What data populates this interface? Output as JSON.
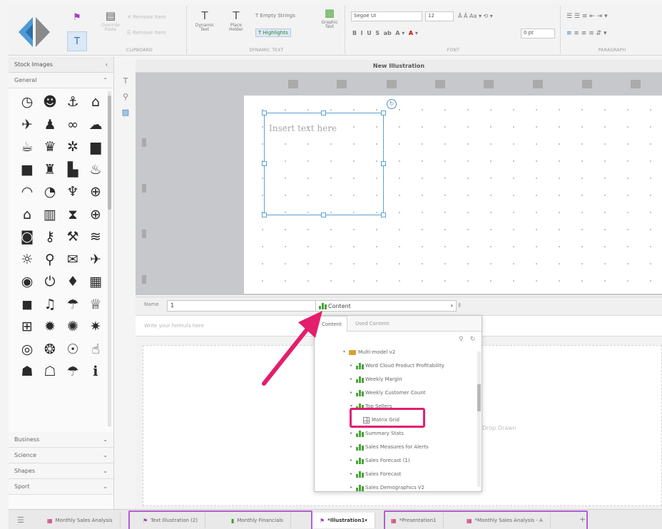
{
  "ribbon": {
    "clipboard": {
      "label": "CLIPBOARD",
      "btn1": "Remove Item",
      "btn2": "Remove Item",
      "paste": "Override Paste"
    },
    "dynamic_text": {
      "label": "DYNAMIC TEXT",
      "dynamic": "Dynamic Text",
      "placeholder": "Place Holder",
      "empty_strings": "Empty Strings",
      "highlights": "Highlights",
      "graphic_text": "Graphic Text"
    },
    "font": {
      "label": "FONT",
      "family": "Segoe UI",
      "size": "12",
      "letter_spacing": "0 pt"
    },
    "paragraph": {
      "label": "PARAGRAPH"
    }
  },
  "left_panel": {
    "title": "Stock Images",
    "category_open": "General",
    "categories": [
      "Business",
      "Science",
      "Shapes",
      "Sport"
    ],
    "icons": [
      {
        "name": "clock-icon",
        "glyph": "◷"
      },
      {
        "name": "head-icon",
        "glyph": "☻"
      },
      {
        "name": "anchor-icon",
        "glyph": "⚓"
      },
      {
        "name": "bank-icon",
        "glyph": "⌂"
      },
      {
        "name": "airplane-icon",
        "glyph": "✈"
      },
      {
        "name": "bell-icon",
        "glyph": "♟"
      },
      {
        "name": "binoculars-icon",
        "glyph": "∞"
      },
      {
        "name": "cloud-sun-icon",
        "glyph": "☁"
      },
      {
        "name": "coffee-icon",
        "glyph": "☕"
      },
      {
        "name": "graduation-cap-icon",
        "glyph": "♛"
      },
      {
        "name": "network-icon",
        "glyph": "✲"
      },
      {
        "name": "truck-icon",
        "glyph": "▆"
      },
      {
        "name": "briefcase-icon",
        "glyph": "■"
      },
      {
        "name": "wine-icon",
        "glyph": "♜"
      },
      {
        "name": "fuel-icon",
        "glyph": "▙"
      },
      {
        "name": "fire-icon",
        "glyph": "♨"
      },
      {
        "name": "dome-icon",
        "glyph": "◠"
      },
      {
        "name": "speedometer-icon",
        "glyph": "◔"
      },
      {
        "name": "trophy-icon",
        "glyph": "♆"
      },
      {
        "name": "globe-icon",
        "glyph": "⊕"
      },
      {
        "name": "home-icon",
        "glyph": "⌂"
      },
      {
        "name": "building-icon",
        "glyph": "▥"
      },
      {
        "name": "hourglass-icon",
        "glyph": "⧗"
      },
      {
        "name": "world-icon",
        "glyph": "⊕"
      },
      {
        "name": "gamepad-icon",
        "glyph": "◙"
      },
      {
        "name": "key-icon",
        "glyph": "⚷"
      },
      {
        "name": "wrench-icon",
        "glyph": "⚒"
      },
      {
        "name": "layers-icon",
        "glyph": "≋"
      },
      {
        "name": "lightbulb-icon",
        "glyph": "☼"
      },
      {
        "name": "location-pin-icon",
        "glyph": "⚲"
      },
      {
        "name": "mail-icon",
        "glyph": "✉"
      },
      {
        "name": "plane-icon",
        "glyph": "✈"
      },
      {
        "name": "power-icon",
        "glyph": "◉"
      },
      {
        "name": "power-button-icon",
        "glyph": "⏻"
      },
      {
        "name": "diamond-icon",
        "glyph": "♦"
      },
      {
        "name": "gift-icon",
        "glyph": "▦"
      },
      {
        "name": "shopping-bag-icon",
        "glyph": "◼"
      },
      {
        "name": "music-icon",
        "glyph": "♫"
      },
      {
        "name": "rain-cloud-icon",
        "glyph": "☂"
      },
      {
        "name": "crown-icon",
        "glyph": "♕"
      },
      {
        "name": "cart-icon",
        "glyph": "⊞"
      },
      {
        "name": "virus-icon",
        "glyph": "✹"
      },
      {
        "name": "sun-icon",
        "glyph": "✺"
      },
      {
        "name": "gear-icon",
        "glyph": "✷"
      },
      {
        "name": "target-icon",
        "glyph": "◎"
      },
      {
        "name": "badge-icon",
        "glyph": "❂"
      },
      {
        "name": "handshake-icon",
        "glyph": "☉"
      },
      {
        "name": "hand-pointer-icon",
        "glyph": "☝"
      },
      {
        "name": "thumbs-up-icon",
        "glyph": "☗"
      },
      {
        "name": "thumbs-up-outline-icon",
        "glyph": "☖"
      },
      {
        "name": "umbrella-icon",
        "glyph": "☂"
      },
      {
        "name": "info-icon",
        "glyph": "ℹ"
      }
    ]
  },
  "document": {
    "title": "New Illustration",
    "textbox_placeholder": "Insert text here"
  },
  "properties": {
    "name_label": "Name",
    "name_value": "1",
    "content_value": "Content",
    "formula_placeholder": "Write your formula here",
    "drop_hint": "Drop Drawn"
  },
  "dropdown": {
    "tabs": [
      "Content",
      "Used Content"
    ],
    "items": [
      {
        "label": "Multi-model v2",
        "kind": "folder",
        "level": 0
      },
      {
        "label": "Word Cloud Product Profitability",
        "kind": "chart",
        "level": 1
      },
      {
        "label": "Weekly Margin",
        "kind": "chart",
        "level": 1
      },
      {
        "label": "Weekly Customer Count",
        "kind": "chart",
        "level": 1
      },
      {
        "label": "Top Sellers",
        "kind": "chart",
        "level": 1
      },
      {
        "label": "Matrix Grid",
        "kind": "matrix",
        "level": 2
      },
      {
        "label": "Summary Stats",
        "kind": "chart",
        "level": 1
      },
      {
        "label": "Sales Measures for Alerts",
        "kind": "chart",
        "level": 1
      },
      {
        "label": "Sales Forecast (1)",
        "kind": "chart",
        "level": 1
      },
      {
        "label": "Sales Forecast",
        "kind": "chart",
        "level": 1
      },
      {
        "label": "Sales Demographics V2",
        "kind": "chart",
        "level": 1
      }
    ]
  },
  "tabs": [
    {
      "label": "Monthly Sales Analysis",
      "icon": "▦",
      "color": "#c9226a"
    },
    {
      "label": "Text Illustration (2)",
      "icon": "⚑",
      "color": "#a83ec0"
    },
    {
      "label": "Monthly Financials",
      "icon": "▮",
      "color": "#3f9b3a"
    },
    {
      "label": "*Illustration1",
      "icon": "⚑",
      "color": "#a83ec0"
    },
    {
      "label": "*Presentation1",
      "icon": "▦",
      "color": "#c9226a"
    },
    {
      "label": "*Monthly Sales Analysis - A",
      "icon": "▦",
      "color": "#c9226a"
    }
  ],
  "colors": {
    "accent": "#a83ec0",
    "annotation": "#e31e6c",
    "selection": "#5aa0d6",
    "green": "#4aa33a"
  }
}
